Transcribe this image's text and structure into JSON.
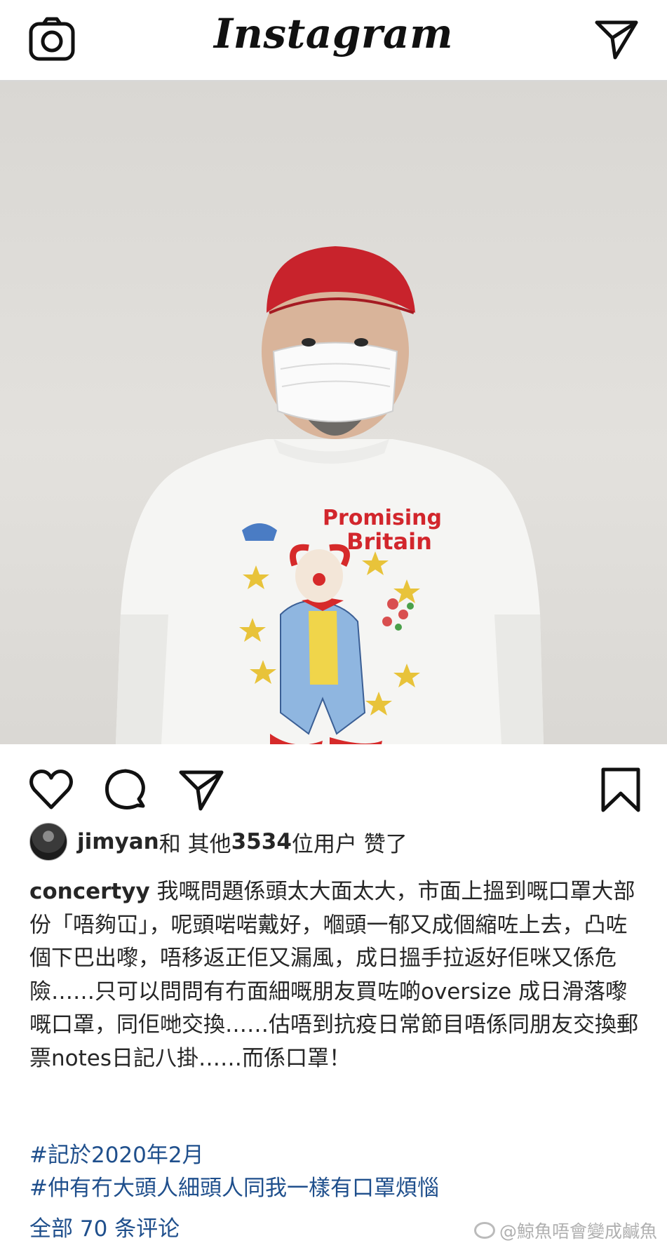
{
  "app": {
    "title": "Instagram"
  },
  "post": {
    "image_alt": "Man wearing a red cap, surgical mask and a white sweatshirt printed with a clown",
    "shirt_text_line1": "Promising",
    "shirt_text_line2": "Britain",
    "likes": {
      "user": "jimyan",
      "middle": " 和 其他 ",
      "count": "3534",
      "suffix": " 位用户 赞了"
    },
    "caption": {
      "user": "concertyy",
      "text": " 我嘅問題係頭太大面太大，市面上搵到嘅口罩大部份「唔夠冚」，呢頭啱啱戴好，嗰頭一郁又成個縮咗上去，凸咗個下巴出嚟，唔移返正佢又漏風，成日搵手拉返好佢咪又係危險……只可以問問有冇面細嘅朋友買咗啲oversize 成日滑落嚟嘅口罩，同佢哋交換……估唔到抗疫日常節目唔係同朋友交換郵票notes日記八掛……而係口罩！"
    },
    "hashtags": [
      "#記於2020年2月",
      "#仲有冇大頭人細頭人同我一樣有口罩煩惱"
    ],
    "comments_link": "全部 70 条评论"
  },
  "watermark": "@鯨魚唔會變成鹹魚",
  "icons": {
    "camera": "camera-icon",
    "direct": "direct-message-icon",
    "like": "heart-icon",
    "comment": "comment-icon",
    "share": "share-icon",
    "save": "bookmark-icon"
  }
}
